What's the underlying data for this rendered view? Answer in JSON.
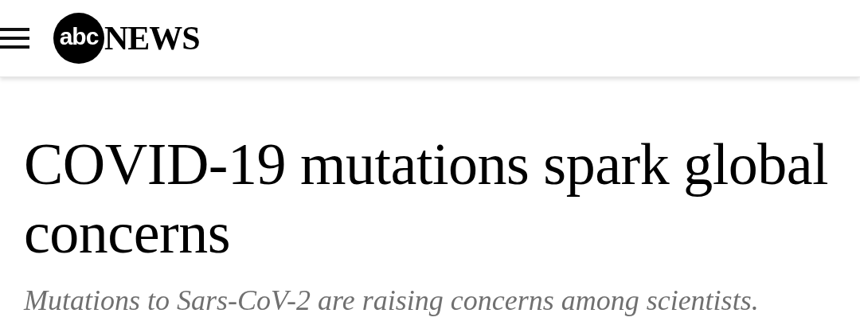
{
  "header": {
    "logo": {
      "mark": "abc",
      "wordmark": "NEWS"
    }
  },
  "article": {
    "headline": "COVID-19 mutations spark global concerns",
    "subheadline": "Mutations to Sars-CoV-2 are raising concerns among scientists."
  }
}
